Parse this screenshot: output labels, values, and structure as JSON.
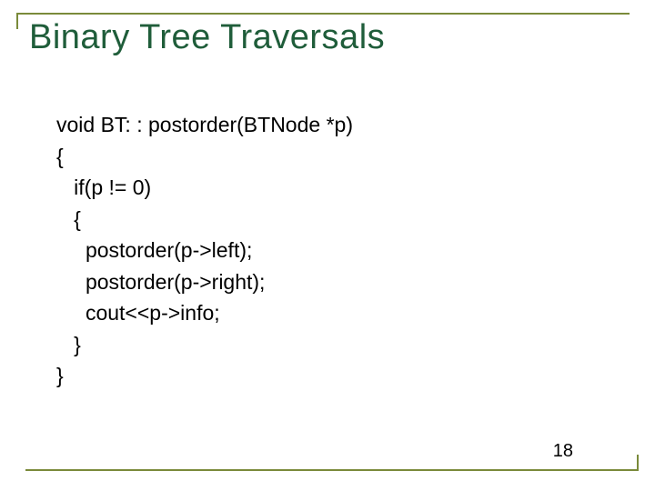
{
  "title": "Binary Tree Traversals",
  "code": {
    "l1": "void BT: : postorder(BTNode *p)",
    "l2": "{",
    "l3": "   if(p != 0)",
    "l4": "   {",
    "l5": "     postorder(p->left);",
    "l6": "     postorder(p->right);",
    "l7": "     cout<<p->info;",
    "l8": "   }",
    "l9": "}"
  },
  "page_number": "18"
}
